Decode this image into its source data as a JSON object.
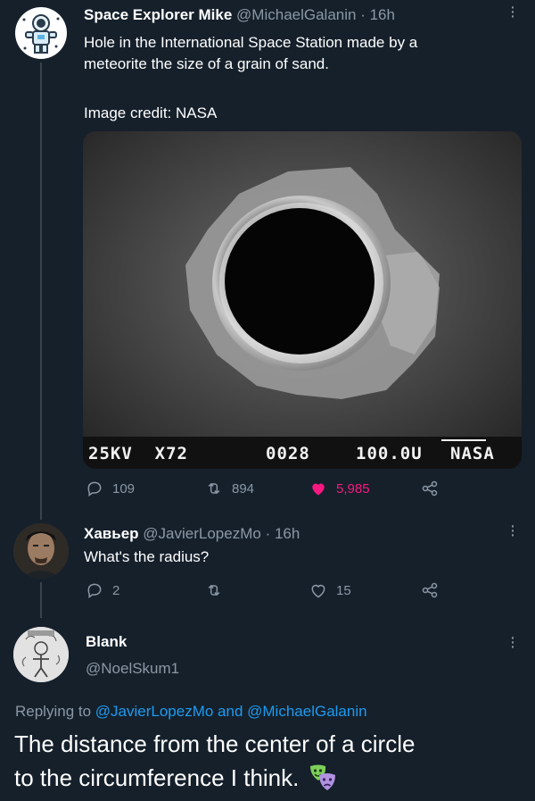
{
  "tweet1": {
    "display_name": "Space Explorer Mike",
    "handle": "@MichaelGalanin",
    "time": "· 16h",
    "text_line1": "Hole in the International Space Station made by a",
    "text_line2": "meteorite the size of a grain of sand.",
    "credit": "Image credit: NASA",
    "media": {
      "label_left": "25KV  X72",
      "label_mid": "0028",
      "label_scale": "100.0U",
      "label_right": "NASA"
    },
    "actions": {
      "replies": "109",
      "retweets": "894",
      "likes": "5,985",
      "like_color": "#f91880"
    }
  },
  "tweet2": {
    "display_name": "Хавьер",
    "handle": "@JavierLopezMo",
    "time": "· 16h",
    "text": "What's the radius?",
    "actions": {
      "replies": "2",
      "retweets": "",
      "likes": "15"
    }
  },
  "tweet3": {
    "display_name": "Blank",
    "handle": "@NoelSkum1",
    "replying_prefix": "Replying to ",
    "replying_user1": "@JavierLopezMo",
    "replying_and": " and ",
    "replying_user2": "@MichaelGalanin",
    "text_line1": "The distance from the center of a circle",
    "text_line2": "to the circumference I think."
  },
  "colors": {
    "background": "#15202b",
    "muted": "#8b98a5",
    "link": "#1d9bf0",
    "like": "#f91880"
  },
  "icons": [
    "astronaut-avatar",
    "reply-icon",
    "retweet-icon",
    "heart-icon",
    "share-icon",
    "more-icon",
    "theater-masks-emoji"
  ]
}
